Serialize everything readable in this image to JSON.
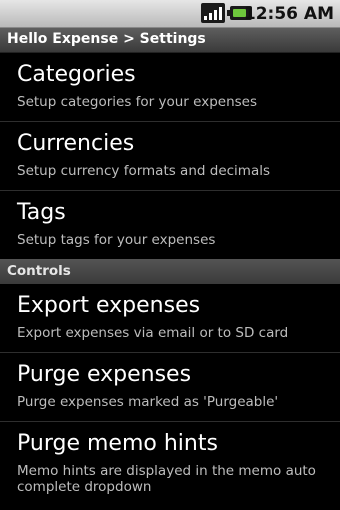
{
  "status_bar": {
    "time": "12:56 AM",
    "signal_icon": "signal-icon",
    "battery_icon": "battery-icon"
  },
  "title_bar": {
    "title": "Hello Expense > Settings"
  },
  "settings": [
    {
      "title": "Categories",
      "summary": "Setup categories for your expenses"
    },
    {
      "title": "Currencies",
      "summary": "Setup currency formats and decimals"
    },
    {
      "title": "Tags",
      "summary": "Setup tags for your expenses"
    }
  ],
  "controls_header": "Controls",
  "controls": [
    {
      "title": "Export expenses",
      "summary": "Export expenses via email or to SD card"
    },
    {
      "title": "Purge expenses",
      "summary": "Purge expenses marked as 'Purgeable'"
    },
    {
      "title": "Purge memo hints",
      "summary": "Memo hints are displayed in the memo auto complete dropdown"
    }
  ]
}
